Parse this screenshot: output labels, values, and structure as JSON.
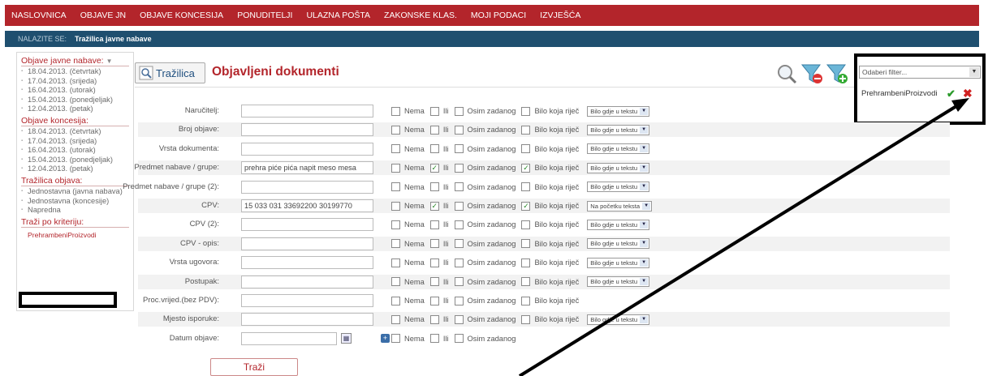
{
  "topnav": [
    "NASLOVNICA",
    "OBJAVE JN",
    "OBJAVE KONCESIJA",
    "PONUDITELJI",
    "ULAZNA POŠTA",
    "ZAKONSKE KLAS.",
    "MOJI PODACI",
    "IZVJEŠĆA"
  ],
  "breadcrumb": {
    "label": "NALAZITE SE:",
    "current": "Tražilica javne nabave"
  },
  "sidebar": {
    "section1": {
      "title": "Objave javne nabave:",
      "items": [
        "18.04.2013. (četvrtak)",
        "17.04.2013. (srijeda)",
        "16.04.2013. (utorak)",
        "15.04.2013. (ponedjeljak)",
        "12.04.2013. (petak)"
      ]
    },
    "section2": {
      "title": "Objave koncesija:",
      "items": [
        "18.04.2013. (četvrtak)",
        "17.04.2013. (srijeda)",
        "16.04.2013. (utorak)",
        "15.04.2013. (ponedjeljak)",
        "12.04.2013. (petak)"
      ]
    },
    "section3": {
      "title": "Tražilica objava:",
      "items": [
        "Jednostavna (javna nabava)",
        "Jednostavna (koncesije)",
        "Napredna"
      ]
    },
    "section4": {
      "title": "Traži po kriteriju:",
      "items": [
        "PrehrambeniProizvodi"
      ]
    }
  },
  "toolbar": {
    "search_label": "Tražilica",
    "title": "Objavljeni dokumenti"
  },
  "filter": {
    "placeholder": "Odaberi filter...",
    "saved": "PrehrambeniProizvodi"
  },
  "options": {
    "nema": "Nema",
    "ili": "Ili",
    "osim": "Osim zadanog",
    "bilo": "Bilo koja riječ"
  },
  "form_rows": [
    {
      "label": "Naručitelj:",
      "value": "",
      "ili": false,
      "bilo": false,
      "select": "Bilo gdje u tekstu"
    },
    {
      "label": "Broj objave:",
      "value": "",
      "ili": false,
      "bilo": false,
      "select": "Bilo gdje u tekstu"
    },
    {
      "label": "Vrsta dokumenta:",
      "value": "",
      "ili": false,
      "bilo": false,
      "select": "Bilo gdje u tekstu"
    },
    {
      "label": "Predmet nabave / grupe:",
      "value": "prehra piće pića napit meso mesa",
      "ili": true,
      "bilo": true,
      "select": "Bilo gdje u tekstu"
    },
    {
      "label": "Predmet nabave / grupe (2):",
      "value": "",
      "ili": false,
      "bilo": false,
      "select": "Bilo gdje u tekstu"
    },
    {
      "label": "CPV:",
      "value": "15 033 031 33692200 30199770",
      "ili": true,
      "bilo": true,
      "select": "Na početku teksta"
    },
    {
      "label": "CPV (2):",
      "value": "",
      "ili": false,
      "bilo": false,
      "select": "Bilo gdje u tekstu"
    },
    {
      "label": "CPV - opis:",
      "value": "",
      "ili": false,
      "bilo": false,
      "select": "Bilo gdje u tekstu"
    },
    {
      "label": "Vrsta ugovora:",
      "value": "",
      "ili": false,
      "bilo": false,
      "select": "Bilo gdje u tekstu"
    },
    {
      "label": "Postupak:",
      "value": "",
      "ili": false,
      "bilo": false,
      "select": "Bilo gdje u tekstu"
    },
    {
      "label": "Proc.vrijed.(bez PDV):",
      "value": "",
      "ili": false,
      "bilo": false,
      "select": null
    },
    {
      "label": "Mjesto isporuke:",
      "value": "",
      "ili": false,
      "bilo": false,
      "select": "Bilo gdje u tekstu"
    }
  ],
  "date_row": {
    "label": "Datum objave:"
  },
  "submit_label": "Traži"
}
